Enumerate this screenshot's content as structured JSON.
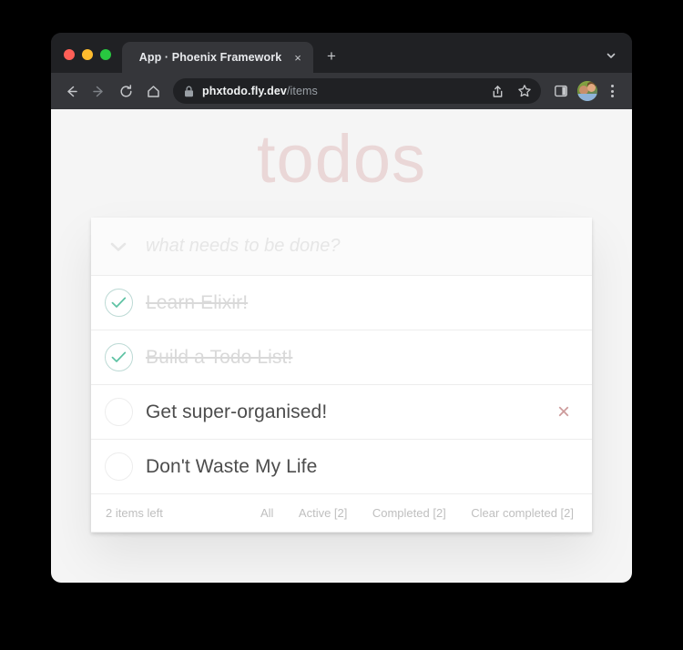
{
  "browser": {
    "tab": {
      "title": "App · Phoenix Framework",
      "close_label": "×",
      "new_tab_label": "+"
    },
    "omnibox": {
      "host": "phxtodo.fly.dev",
      "path": "/items",
      "lock_icon": "lock-icon"
    },
    "icons": {
      "back": "back-arrow-icon",
      "forward": "forward-arrow-icon",
      "reload": "reload-icon",
      "home": "home-icon",
      "share": "share-icon",
      "bookmark": "star-icon",
      "side_panel": "side-panel-icon",
      "avatar": "profile-avatar",
      "menu": "three-dot-menu-icon",
      "tab_list": "chevron-down-icon"
    }
  },
  "page": {
    "title": "todos",
    "new_todo": {
      "placeholder": "what needs to be done?",
      "value": "",
      "toggle_all_icon": "chevron-down-icon"
    },
    "todos": [
      {
        "label": "Learn Elixir!",
        "completed": true,
        "show_destroy": false
      },
      {
        "label": "Build a Todo List!",
        "completed": true,
        "show_destroy": false
      },
      {
        "label": "Get super-organised!",
        "completed": false,
        "show_destroy": true
      },
      {
        "label": "Don't Waste My Life",
        "completed": false,
        "show_destroy": false
      }
    ],
    "footer": {
      "count_text": "2 items left",
      "filters": [
        {
          "label": "All"
        },
        {
          "label": "Active [2]"
        },
        {
          "label": "Completed [2]"
        }
      ],
      "clear_completed": "Clear completed [2]"
    },
    "destroy_glyph": "×"
  },
  "colors": {
    "title": "#ead7d7",
    "check": "#5dc2a3",
    "destroy": "#cc9a9a",
    "text": "#4d4d4d",
    "completed_text": "#d9d9d9",
    "footer_text": "#bfbfbf",
    "page_bg": "#f5f5f5"
  }
}
